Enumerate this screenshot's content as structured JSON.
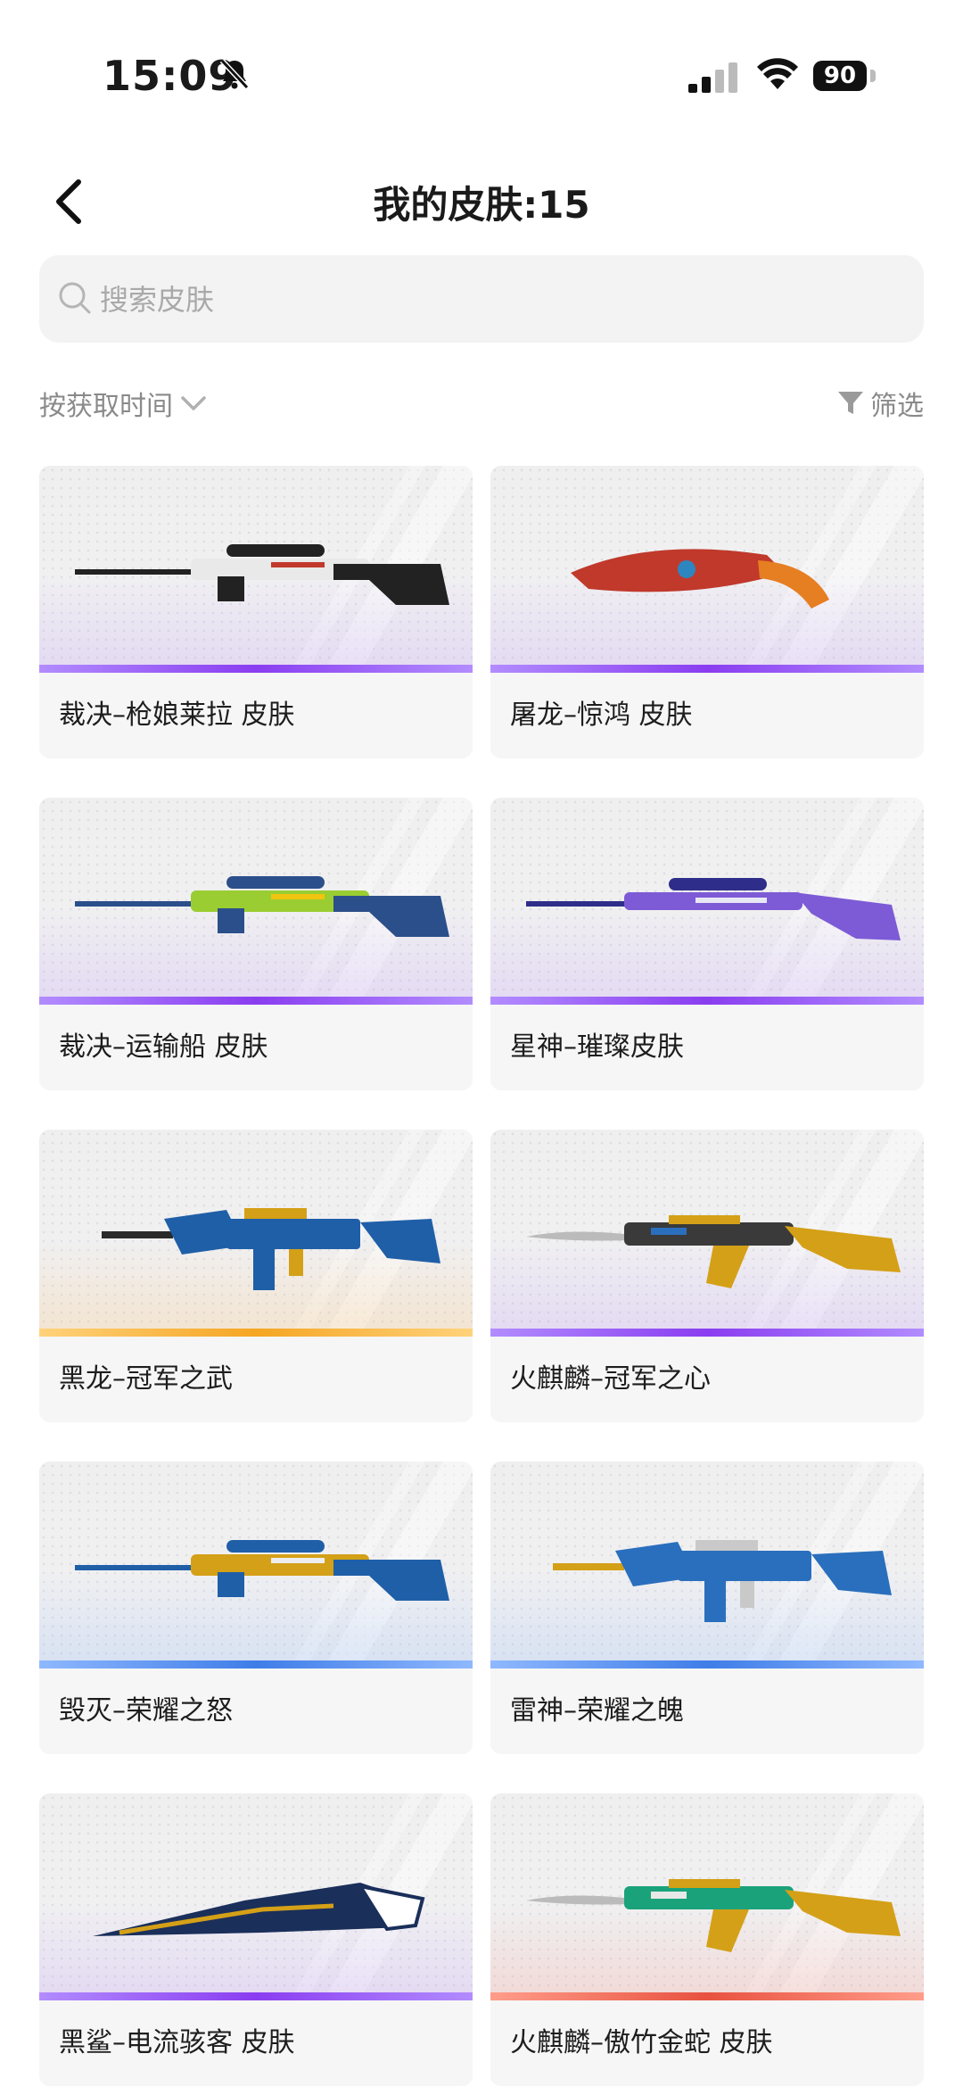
{
  "status_bar": {
    "time": "15:09",
    "battery": "90"
  },
  "header": {
    "title": "我的皮肤:15"
  },
  "search": {
    "placeholder": "搜索皮肤"
  },
  "sort": {
    "label": "按获取时间"
  },
  "filter": {
    "label": "筛选"
  },
  "skins": [
    {
      "name": "裁决–枪娘莱拉 皮肤",
      "tier": "purple",
      "weapon": "sniper",
      "colors": [
        "#222222",
        "#e9e9e9",
        "#c0392b"
      ]
    },
    {
      "name": "屠龙–惊鸿 皮肤",
      "tier": "purple",
      "weapon": "knife",
      "colors": [
        "#c0392b",
        "#e67e22",
        "#2e86c1"
      ]
    },
    {
      "name": "裁决–运输船 皮肤",
      "tier": "purple",
      "weapon": "sniper",
      "colors": [
        "#2b4f8a",
        "#9acd32",
        "#f1c40f"
      ]
    },
    {
      "name": "星神–璀璨皮肤",
      "tier": "purple",
      "weapon": "rifle",
      "colors": [
        "#2e2e8a",
        "#7d5bd6",
        "#e8e8f5"
      ]
    },
    {
      "name": "黑龙–冠军之武",
      "tier": "orange",
      "weapon": "m4",
      "colors": [
        "#1f5fa8",
        "#d4a017",
        "#2a2a2a"
      ]
    },
    {
      "name": "火麒麟–冠军之心",
      "tier": "purple",
      "weapon": "ak",
      "colors": [
        "#3a3a3a",
        "#d4a017",
        "#2a6fbd"
      ]
    },
    {
      "name": "毁灭–荣耀之怒",
      "tier": "blue",
      "weapon": "sniper",
      "colors": [
        "#1f5fa8",
        "#d4a017",
        "#eeeeee"
      ]
    },
    {
      "name": "雷神–荣耀之魄",
      "tier": "blue",
      "weapon": "m4",
      "colors": [
        "#2a6fbd",
        "#c9c9c9",
        "#d4a017"
      ]
    },
    {
      "name": "黑鲨–电流骇客 皮肤",
      "tier": "purple",
      "weapon": "blade",
      "colors": [
        "#1a2f5a",
        "#d4a017",
        "#ffffff"
      ]
    },
    {
      "name": "火麒麟–傲竹金蛇 皮肤",
      "tier": "red",
      "weapon": "ak",
      "colors": [
        "#1aa37a",
        "#d4a017",
        "#e8e8e8"
      ]
    }
  ]
}
